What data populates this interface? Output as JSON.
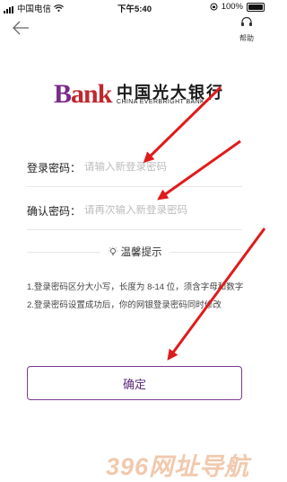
{
  "status_bar": {
    "carrier": "中国电信",
    "time": "下午5:40",
    "battery": "100%"
  },
  "nav": {
    "back_icon": "back-arrow-icon",
    "help_label": "帮助",
    "help_icon": "headset-icon"
  },
  "logo": {
    "mark_b": "B",
    "mark_rest": "ank",
    "name_cn": "中国光大银行",
    "name_en": "CHINA EVERBRIGHT BANK"
  },
  "form": {
    "login_password": {
      "label": "登录密码：",
      "placeholder": "请输入新登录密码"
    },
    "confirm_password": {
      "label": "确认密码：",
      "placeholder": "请再次输入新登录密码"
    }
  },
  "tips": {
    "title": "温馨提示",
    "icon": "lightbulb-icon",
    "items": [
      "1.登录密码区分大小写，长度为 8-14 位，须含字母和数字",
      "2.登录密码设置成功后，你的网银登录密码同时修改"
    ]
  },
  "confirm_button": {
    "label": "确定"
  },
  "watermark": "396网址导航",
  "colors": {
    "accent": "#7b3a8f",
    "brand_red": "#c0272d",
    "arrow": "#e01b1b"
  }
}
